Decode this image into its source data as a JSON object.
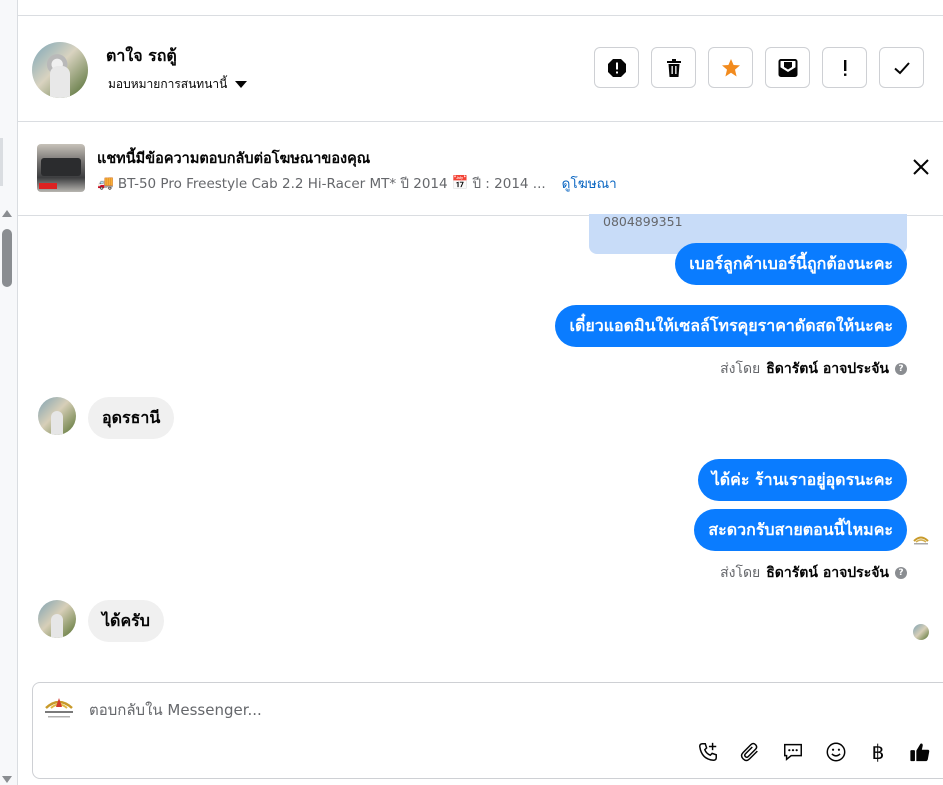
{
  "header": {
    "contact_name": "ตาใจ รถตู้",
    "assign_label": "มอบหมายการสนทนานี้",
    "actions": [
      "spam-icon",
      "trash-icon",
      "star-icon",
      "mark-unread-icon",
      "exclamation-icon",
      "check-icon"
    ]
  },
  "ad_banner": {
    "title": "แชทนี้มีข้อความตอบกลับต่อโฆษณาของคุณ",
    "car": "BT-50 Pro Freestyle Cab 2.2 Hi-Racer MT* ปี 2014",
    "year": "ปี : 2014 ...",
    "view_ad": "ดูโฆษณา"
  },
  "messages": {
    "prev_phone": "0804899351",
    "m1": "เบอร์ลูกค้าเบอร์นี้ถูกต้องนะคะ",
    "m2": "เดี๋ยวแอดมินให้เซลล์โทรคุยราคาดัดสดให้นะคะ",
    "sent_by_prefix": "ส่งโดย",
    "sent_by_name": "ธิดารัตน์ อาจประจัน",
    "m3": "อุดรธานี",
    "m4": "ได้ค่ะ ร้านเราอยู่อุดรนะคะ",
    "m5": "สะดวกรับสายตอนนี้ไหมคะ",
    "m6": "ได้ครับ"
  },
  "composer": {
    "placeholder": "ตอบกลับใน Messenger...",
    "currency_symbol": "฿"
  },
  "colors": {
    "accent": "#0a7cff",
    "star": "#f28b1e",
    "link": "#0a66c2"
  }
}
